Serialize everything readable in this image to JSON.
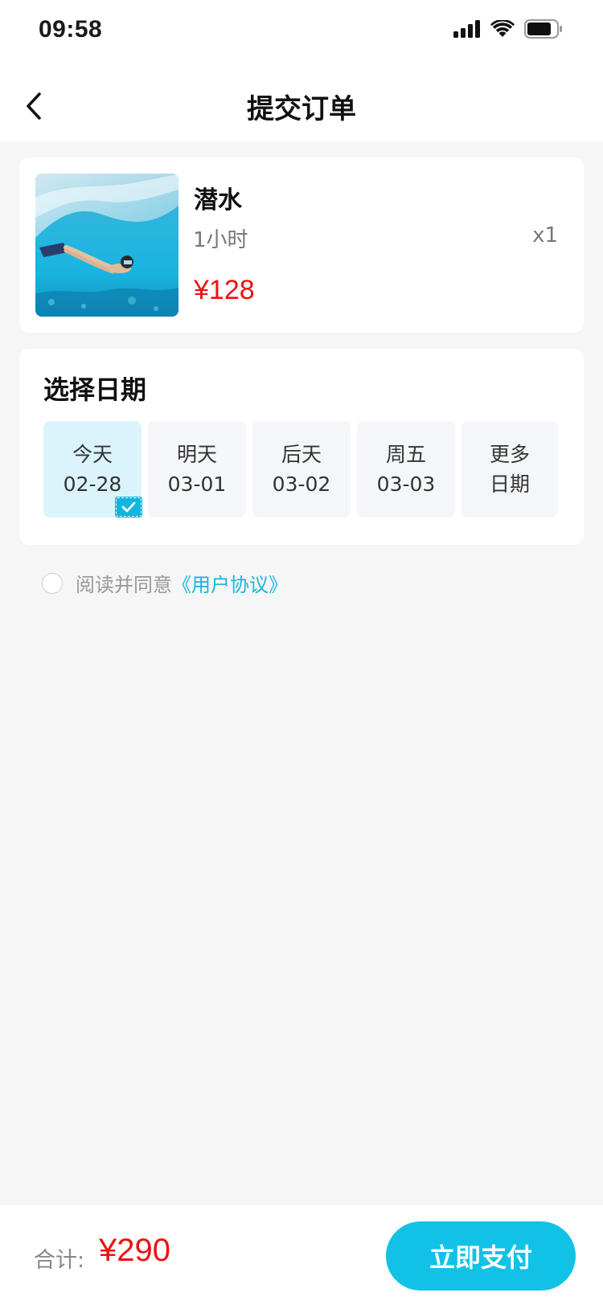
{
  "status_bar": {
    "time": "09:58",
    "icons": [
      "signal-icon",
      "wifi-icon",
      "battery-icon"
    ]
  },
  "nav": {
    "title": "提交订单",
    "back_icon": "chevron-left-icon"
  },
  "product": {
    "name": "潜水",
    "duration": "1小时",
    "quantity": "x1",
    "price": "¥128",
    "image_icon": "diver-photo"
  },
  "date_picker": {
    "title": "选择日期",
    "options": [
      {
        "line1": "今天",
        "line2": "02-28",
        "selected": true
      },
      {
        "line1": "明天",
        "line2": "03-01",
        "selected": false
      },
      {
        "line1": "后天",
        "line2": "03-02",
        "selected": false
      },
      {
        "line1": "周五",
        "line2": "03-03",
        "selected": false
      },
      {
        "line1": "更多",
        "line2": "日期",
        "selected": false
      }
    ]
  },
  "agreement": {
    "text": "阅读并同意",
    "link": "《用户协议》",
    "checked": false
  },
  "bottom_bar": {
    "total_label": "合计:",
    "total_amount": "¥290",
    "pay_label": "立即支付"
  },
  "colors": {
    "accent": "#12c2e6",
    "price": "#ee1111",
    "link": "#17b6de",
    "selected_bg": "#dbf4fb"
  }
}
